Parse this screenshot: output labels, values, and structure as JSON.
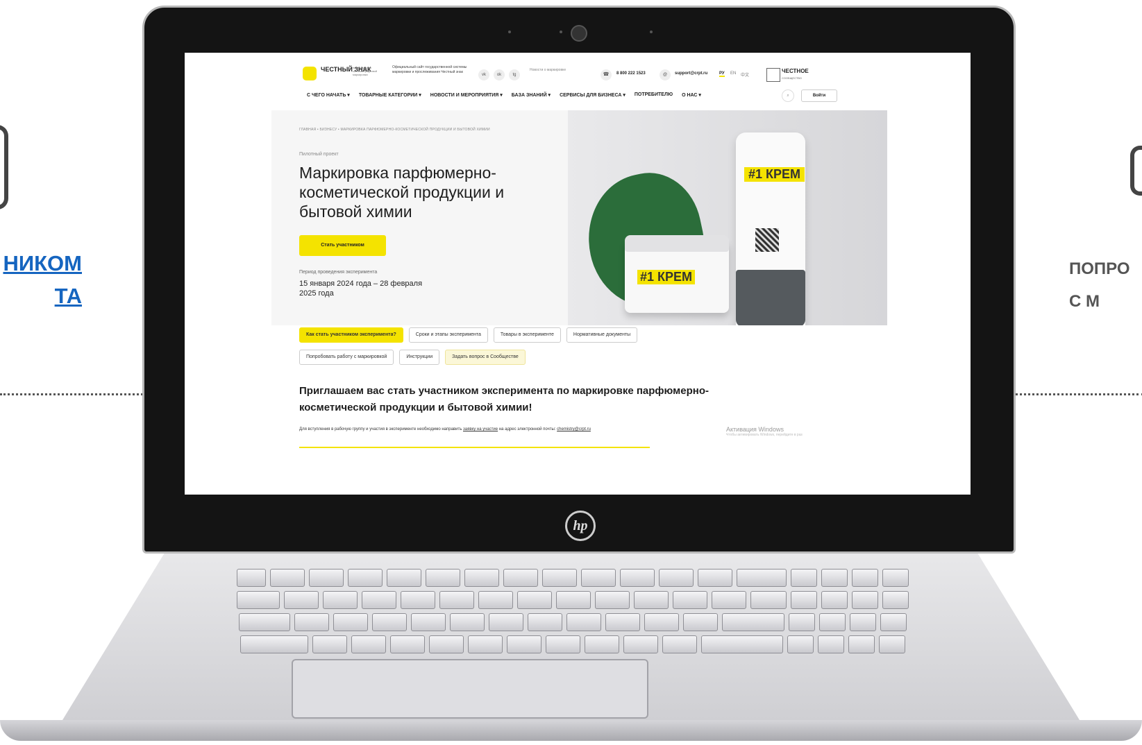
{
  "slide": {
    "left_label_line1": "НИКОМ",
    "left_label_line2": "ТА",
    "right_label_line1": "ПОПРО",
    "right_label_line2": "С М"
  },
  "laptop": {
    "brand": "hp"
  },
  "header": {
    "logo_title": "ЧЕСТНЫЙ ЗНАК",
    "logo_sub": "национальная система цифровой маркировки",
    "official": "Официальный сайт государственной системы маркировки и прослеживания Честный знак",
    "social": [
      "vk",
      "ok",
      "tg"
    ],
    "news": "Новости о маркировке",
    "phone": "8 800 222 1523",
    "email": "support@crpt.ru",
    "langs": [
      "РУ",
      "EN",
      "中文"
    ],
    "community_title": "ЧЕСТНОЕ",
    "community_sub": "СООБЩЕСТВО",
    "login": "Войти"
  },
  "nav": [
    "С ЧЕГО НАЧАТЬ ▾",
    "ТОВАРНЫЕ КАТЕГОРИИ ▾",
    "НОВОСТИ И МЕРОПРИЯТИЯ ▾",
    "БАЗА ЗНАНИЙ ▾",
    "СЕРВИСЫ ДЛЯ БИЗНЕСА ▾",
    "ПОТРЕБИТЕЛЮ",
    "О НАС ▾"
  ],
  "hero": {
    "breadcrumbs": "ГЛАВНАЯ • БИЗНЕСУ • МАРКИРОВКА ПАРФЮМЕРНО-КОСМЕТИЧЕСКОЙ ПРОДУКЦИИ И БЫТОВОЙ ХИМИИ",
    "pilot": "Пилотный проект",
    "title": "Маркировка парфюмерно-косметической продукции и бытовой химии",
    "cta": "Стать участником",
    "period_label": "Период проведения эксперимента",
    "period_value": "15 января 2024 года – 28 февраля 2025 года",
    "product_label_jar": "#1 КРЕМ",
    "product_label_tube": "#1 КРЕМ"
  },
  "tabs": {
    "row1": [
      "Как стать участником эксперимента?",
      "Сроки и этапы эксперимента",
      "Товары в эксперименте",
      "Нормативные документы"
    ],
    "row2": [
      "Попробовать работу с маркировкой",
      "Инструкции",
      "Задать вопрос в Сообществе"
    ]
  },
  "content": {
    "invite": "Приглашаем вас стать участником эксперимента по маркировке парфюмерно-косметической продукции и бытовой химии!",
    "note_prefix": "Для вступления в рабочую группу и участия в эксперименте необходимо направить",
    "note_link": "заявку на участие",
    "note_mid": "на адрес электронной почты:",
    "note_email": "chemistry@crpt.ru"
  },
  "windows_overlay": {
    "title": "Активация Windows",
    "sub": "Чтобы активировать Windows, перейдите в раз"
  },
  "colors": {
    "accent": "#f4e300",
    "link_blue": "#1565c0"
  }
}
